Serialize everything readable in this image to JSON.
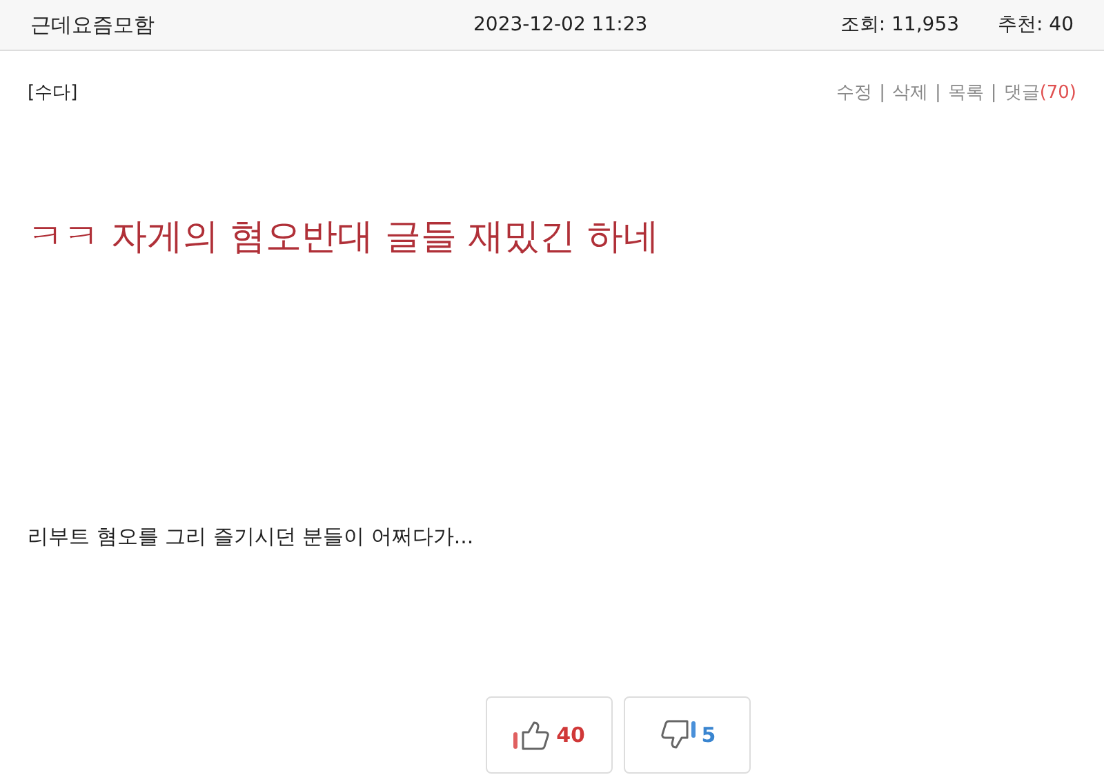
{
  "header": {
    "author": "근데요즘모함",
    "datetime": "2023-12-02 11:23",
    "views": "조회: 11,953",
    "recommends": "추천: 40"
  },
  "category": "[수다]",
  "actions": {
    "separator": "|",
    "links": [
      "수정",
      "삭제",
      "목록"
    ],
    "comments": {
      "label": "댓글",
      "count": "(70)"
    }
  },
  "title": "ㅋㅋ 자게의 혐오반대 글들 재밌긴 하네",
  "body": "리부트 혐오를 그리 즐기시던 분들이 어쩌다가...",
  "votes": [
    {
      "kind": "up",
      "count": "40"
    },
    {
      "kind": "down",
      "count": "5"
    }
  ]
}
